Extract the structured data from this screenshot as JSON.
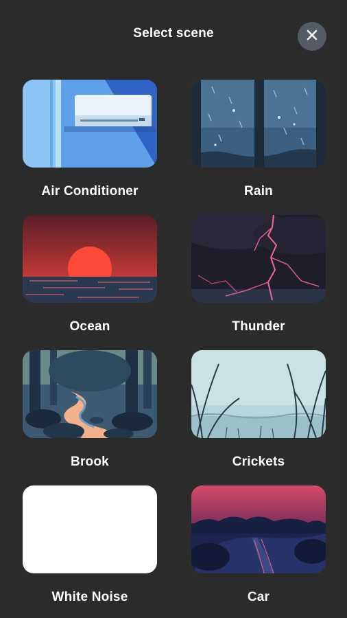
{
  "header": {
    "title": "Select scene",
    "close_icon": "close-icon"
  },
  "scenes": [
    {
      "label": "Air Conditioner",
      "icon": "air-conditioner-image"
    },
    {
      "label": "Rain",
      "icon": "rain-window-image"
    },
    {
      "label": "Ocean",
      "icon": "ocean-sunset-image"
    },
    {
      "label": "Thunder",
      "icon": "thunder-lightning-image"
    },
    {
      "label": "Brook",
      "icon": "brook-forest-image"
    },
    {
      "label": "Crickets",
      "icon": "crickets-grass-image"
    },
    {
      "label": "White Noise",
      "icon": "white-noise-image"
    },
    {
      "label": "Car",
      "icon": "car-road-image"
    }
  ],
  "colors": {
    "background": "#2b2b2b",
    "close_button": "#555b66",
    "text": "#ffffff"
  }
}
